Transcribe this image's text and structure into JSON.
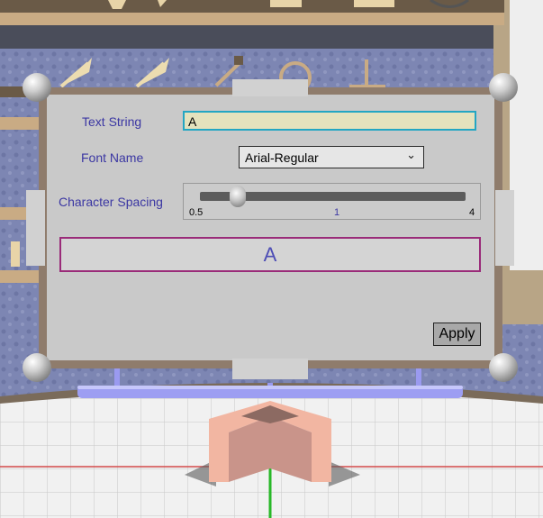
{
  "form": {
    "text_string_label": "Text String",
    "text_string_value": "A",
    "font_name_label": "Font Name",
    "font_name_value": "Arial-Regular",
    "character_spacing_label": "Character Spacing",
    "character_spacing": {
      "min": "0.5",
      "mid": "1",
      "max": "4",
      "value": 1
    },
    "preview_text": "A",
    "apply_label": "Apply"
  },
  "colors": {
    "label": "#3b37a3",
    "input_border": "#23a6c3",
    "input_bg": "#e4e2bd",
    "preview_border": "#9a2b79",
    "preview_text": "#4d4db5"
  },
  "icons": [
    "chevron-down-icon"
  ]
}
